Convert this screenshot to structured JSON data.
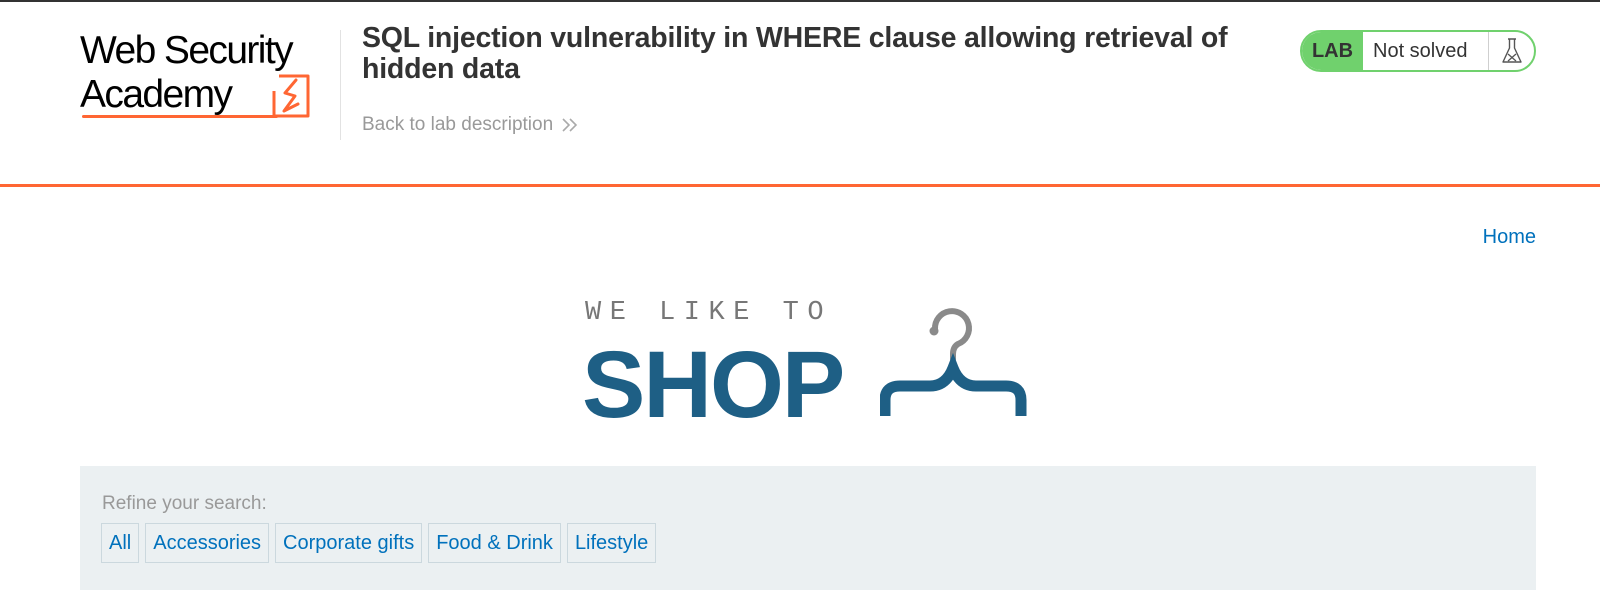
{
  "academy": {
    "logo_line1": "Web Security",
    "logo_line2": "Academy",
    "lab_title": "SQL injection vulnerability in WHERE clause allowing retrieval of hidden data",
    "back_link": "Back to lab description",
    "status_tag": "LAB",
    "status_text": "Not solved"
  },
  "nav": {
    "home": "Home"
  },
  "shop_logo": {
    "tagline": "WE LIKE TO",
    "word": "SHOP"
  },
  "filters": {
    "label": "Refine your search:",
    "categories": [
      "All",
      "Accessories",
      "Corporate gifts",
      "Food & Drink",
      "Lifestyle"
    ]
  },
  "colors": {
    "accent": "#ff6633",
    "status_green": "#70d16d",
    "link": "#0071bc",
    "shop_blue": "#1e5f85",
    "panel_bg": "#ebf0f2"
  },
  "icons": {
    "logo_mark": "lightning-bolt-icon",
    "back_chevron": "double-chevron-right-icon",
    "status": "flask-icon",
    "shop": "coat-hanger-icon"
  }
}
